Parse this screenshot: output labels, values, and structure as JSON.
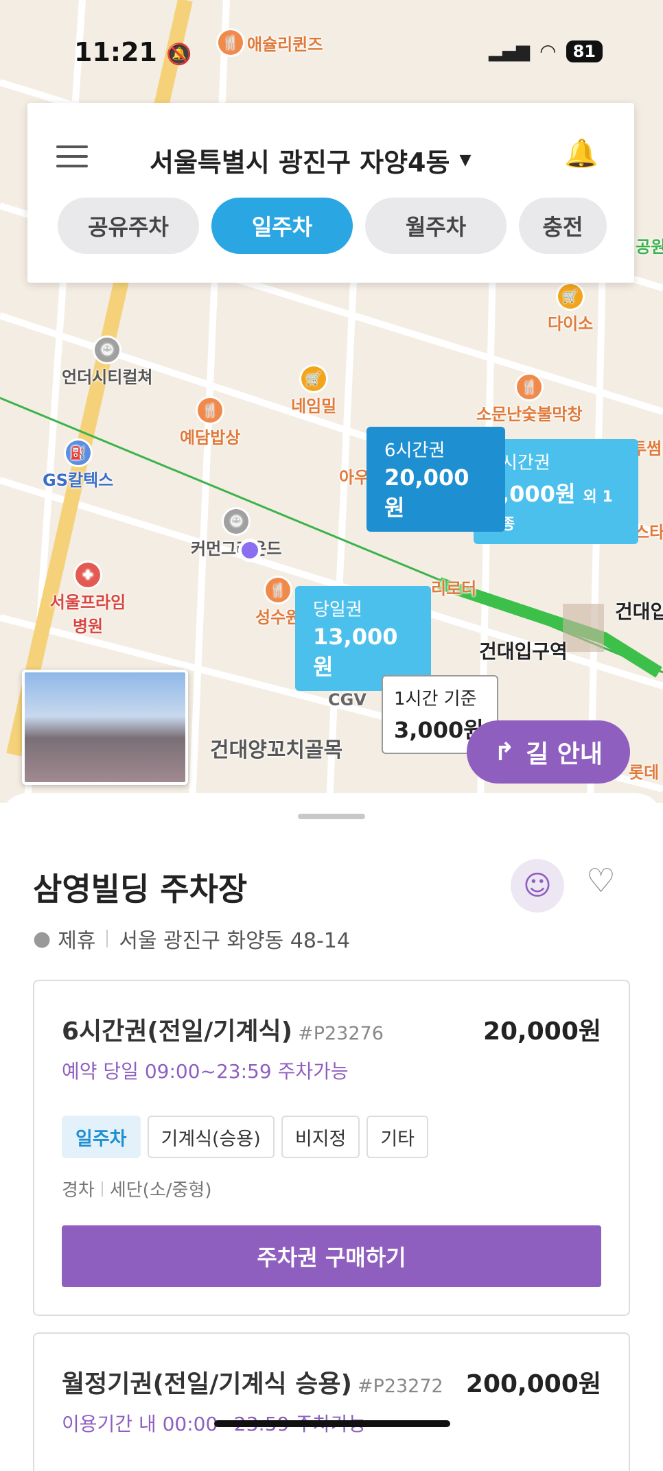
{
  "status_bar": {
    "time": "11:21",
    "battery": "81"
  },
  "header": {
    "location": "서울특별시 광진구 자양4동",
    "tabs": [
      {
        "label": "공유주차",
        "active": false
      },
      {
        "label": "일주차",
        "active": true
      },
      {
        "label": "월주차",
        "active": false
      },
      {
        "label": "충전",
        "active": false
      }
    ]
  },
  "map": {
    "pois": [
      "애슐리퀸즈",
      "다이소",
      "언더시티컬쳐",
      "네임밀",
      "소문난숯불막창",
      "예담밥상",
      "GS칼텍스",
      "커먼그라운드",
      "서울프라임병원",
      "성수원",
      "건대입구역",
      "CGV",
      "건대양꼬치골목",
      "아우",
      "건대입",
      "공원",
      "투썸",
      "스타",
      "롯데",
      "리로터"
    ],
    "bubbles": [
      {
        "title": "6시간권",
        "price": "20,000원"
      },
      {
        "title": "시간권",
        "price": ",000원",
        "extra": "외 1종"
      },
      {
        "title": "당일권",
        "price": "13,000원"
      },
      {
        "title": "1시간 기준",
        "price": "3,000원"
      }
    ],
    "nav_button": "길 안내"
  },
  "lot": {
    "name": "삼영빌딩 주차장",
    "partner": "제휴",
    "address": "서울 광진구 화양동 48-14"
  },
  "tickets": [
    {
      "name": "6시간권(전일/기계식)",
      "code": "#P23276",
      "price": "20,000원",
      "availability": "예약 당일 09:00~23:59 주차가능",
      "tags": [
        "일주차",
        "기계식(승용)",
        "비지정",
        "기타"
      ],
      "cars": [
        "경차",
        "세단(소/중형)"
      ],
      "button": "주차권 구매하기"
    },
    {
      "name": "월정기권(전일/기계식 승용)",
      "code": "#P23272",
      "price": "200,000원",
      "availability": "이용기간 내 00:00~23:59 주차가능"
    }
  ]
}
